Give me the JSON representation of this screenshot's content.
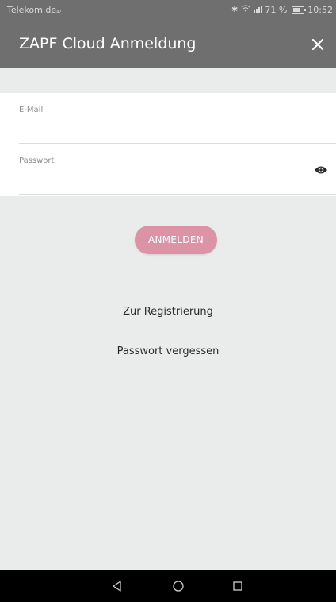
{
  "status_bar": {
    "carrier": "Telekom.de",
    "carrier_suffix": "₄₇",
    "battery": "71 %",
    "time": "10:52"
  },
  "app_bar": {
    "title": "ZAPF Cloud Anmeldung",
    "close_icon": "close-icon"
  },
  "form": {
    "email": {
      "label": "E-Mail",
      "value": "",
      "placeholder": ""
    },
    "password": {
      "label": "Passwort",
      "value": "",
      "placeholder": "",
      "toggle_icon": "eye-icon"
    }
  },
  "actions": {
    "login_label": "ANMELDEN",
    "register_label": "Zur Registrierung",
    "forgot_label": "Passwort vergessen"
  },
  "nav_bar": {
    "back_icon": "back-triangle-icon",
    "home_icon": "home-circle-icon",
    "recents_icon": "recents-square-icon"
  },
  "colors": {
    "app_bar": "#6f6f6f",
    "background": "#e9eceb",
    "login_button": "#dc93a6",
    "nav_bar": "#000000"
  }
}
